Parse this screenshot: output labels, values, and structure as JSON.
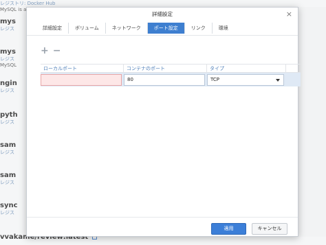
{
  "background": {
    "items": [
      {
        "name": "",
        "sub": "レジストリ: Docker Hub",
        "desc": "MySQL is a"
      },
      {
        "name": "mys",
        "sub": "レジス",
        "desc": ""
      },
      {
        "name": "mys",
        "sub": "レジス",
        "desc": "MySQL"
      },
      {
        "name": "ngin",
        "sub": "レジス",
        "desc": ""
      },
      {
        "name": "pyth",
        "sub": "レジス",
        "desc": ""
      },
      {
        "name": "sam",
        "sub": "レジス",
        "desc": ""
      },
      {
        "name": "sam",
        "sub": "レジス",
        "desc": ""
      },
      {
        "name": "sync",
        "sub": "レジス",
        "desc": ""
      },
      {
        "name": "vvakame/review:latest",
        "sub": "",
        "desc": ""
      }
    ]
  },
  "dialog": {
    "title": "詳細設定",
    "close_glyph": "×",
    "tabs": [
      {
        "label": "詳細設定",
        "active": false
      },
      {
        "label": "ボリューム",
        "active": false
      },
      {
        "label": "ネットワーク",
        "active": false
      },
      {
        "label": "ポート設定",
        "active": true
      },
      {
        "label": "リンク",
        "active": false
      },
      {
        "label": "環境",
        "active": false
      }
    ],
    "toolbar": {
      "add_glyph": "+",
      "remove_glyph": "−"
    },
    "grid": {
      "columns": [
        "ローカルポート",
        "コンテナのポート",
        "タイプ"
      ],
      "rows": [
        {
          "local_port": "",
          "container_port": "80",
          "type": "TCP"
        }
      ]
    },
    "buttons": {
      "apply": "適用",
      "cancel": "キャンセル"
    }
  }
}
